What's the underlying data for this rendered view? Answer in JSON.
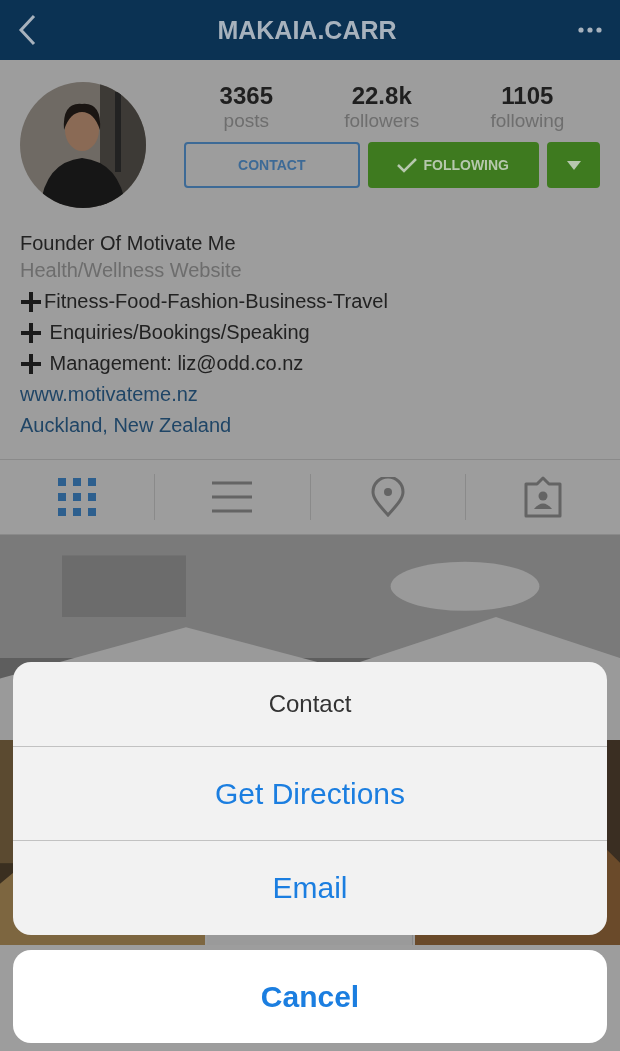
{
  "header": {
    "title": "MAKAIA.CARR"
  },
  "profile": {
    "stats": [
      {
        "value": "3365",
        "label": "posts"
      },
      {
        "value": "22.8k",
        "label": "followers"
      },
      {
        "value": "1105",
        "label": "following"
      }
    ],
    "contact_button": "CONTACT",
    "follow_button": {
      "label": "FOLLOWING",
      "following": true
    }
  },
  "bio": {
    "name": "Founder Of Motivate Me",
    "category": "Health/Wellness Website",
    "lines": [
      {
        "kind": "plus",
        "text": "Fitness-Food-Fashion-Business-Travel"
      },
      {
        "kind": "plus",
        "text": " Enquiries/Bookings/Speaking"
      },
      {
        "kind": "plus",
        "text": " Management: liz@odd.co.nz"
      }
    ],
    "website": "www.motivateme.nz",
    "location": "Auckland, New Zealand"
  },
  "tabs": [
    {
      "kind": "grid",
      "selected": true
    },
    {
      "kind": "list",
      "selected": false
    },
    {
      "kind": "place",
      "selected": false
    },
    {
      "kind": "tagged",
      "selected": false
    }
  ],
  "action_sheet": {
    "title": "Contact",
    "actions": [
      "Get Directions",
      "Email"
    ],
    "cancel": "Cancel"
  }
}
